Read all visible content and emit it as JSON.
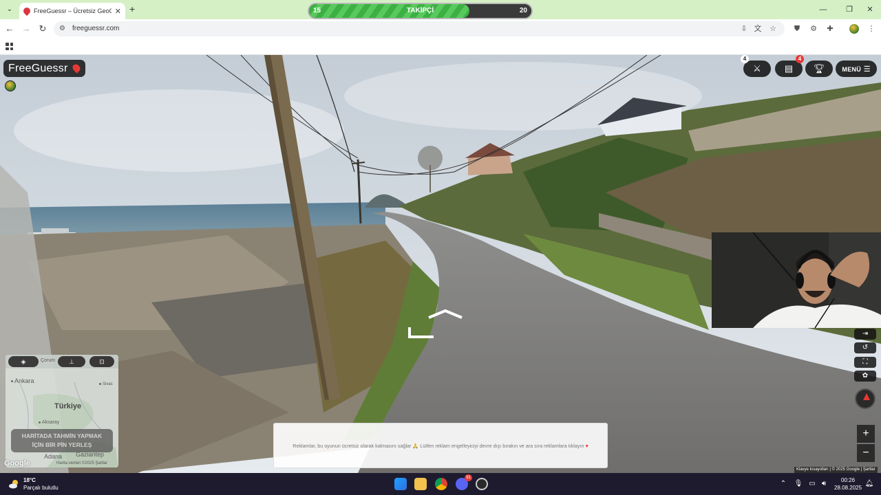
{
  "browser": {
    "tab_title": "FreeGuessr – Ücretsiz GeoGuessr",
    "tab_close": "✕",
    "new_tab": "+",
    "url": "freeguessr.com"
  },
  "follower_goal": {
    "label": "TAKİPÇİ",
    "start": "15",
    "end": "20",
    "progress_fraction": 0.72,
    "fill_color": "#3cb043"
  },
  "game": {
    "logo_text": "FreeGuessr",
    "duel_badge": "4",
    "inbox_badge": "4",
    "menu_label": "MENÜ",
    "icons": {
      "duel": "crossed-swords-icon",
      "inbox": "printer-icon",
      "leaderboard": "trophy-icon",
      "menu": "hamburger-icon"
    }
  },
  "minimap": {
    "labels": {
      "ankara": "Ankara",
      "corum": "Çorum",
      "sivas": "Sivas",
      "country": "Türkiye",
      "aksaray": "Aksaray",
      "adana": "Adana",
      "gaziantep": "Gaziantep"
    },
    "guess_line1": "HARİTADA TAHMİN YAPMAK",
    "guess_line2": "İÇİN BİR PİN YERLEŞ",
    "google_logo": "Google",
    "attribution": "Harita verileri ©2025   Şartlar"
  },
  "ad_notice": {
    "text": "Reklamlar, bu oyunun ücretsiz olarak kalmasını sağlar 🙏 Lütfen reklam engelleyiciyi devre dışı bırakın ve ara sıra reklamlara tıklayın",
    "heart": "♥"
  },
  "streetview_attribution": "Klavye kısayolları  |  © 2025 Google  |  Şartlar",
  "taskbar": {
    "weather_temp": "18°C",
    "weather_cond": "Parçalı bulutlu",
    "discord_badge": "91",
    "time": "00:26",
    "date": "28.08.2025"
  },
  "colors": {
    "tabbar_bg": "#d6f0c6",
    "taskbar_bg": "#1e1b2e",
    "hud_bg": "#141414",
    "brand_pin": "#e53935"
  }
}
